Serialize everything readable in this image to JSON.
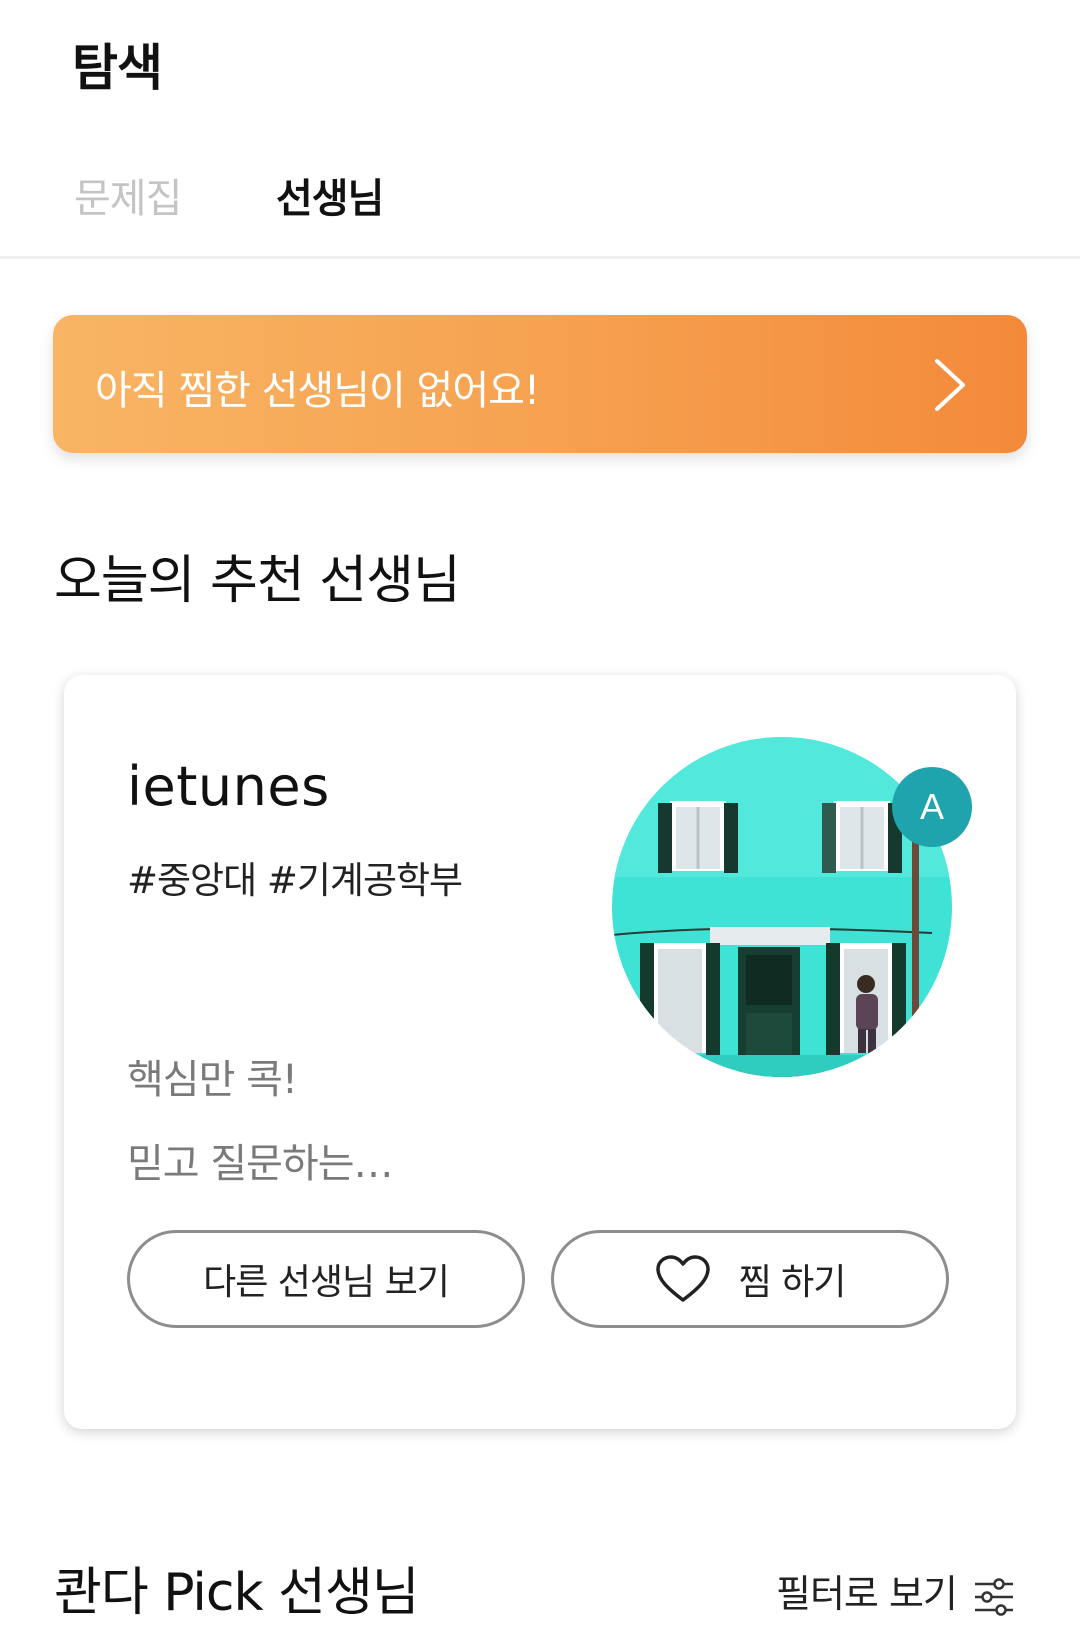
{
  "header": {
    "title": "탐색",
    "tabs": [
      {
        "label": "문제집",
        "active": false
      },
      {
        "label": "선생님",
        "active": true
      }
    ]
  },
  "banner": {
    "text": "아직 찜한 선생님이 없어요!",
    "icon": "chevron-right-icon",
    "colors": {
      "start": "#f8b564",
      "end": "#f38a3a"
    }
  },
  "recommended": {
    "title": "오늘의 추천 선생님",
    "teacher": {
      "name": "ietunes",
      "tags": "#중앙대 #기계공학부",
      "intro_line1": "핵심만 콕!",
      "intro_line2": "믿고 질문하는…",
      "badge_letter": "A",
      "badge_color": "#1fa3ad"
    },
    "buttons": {
      "other_label": "다른 선생님 보기",
      "like_label": "찜 하기",
      "like_icon": "heart-outline-icon"
    }
  },
  "pick": {
    "title": "콴다 Pick 선생님",
    "filter_label": "필터로 보기",
    "filter_icon": "filter-sliders-icon"
  }
}
